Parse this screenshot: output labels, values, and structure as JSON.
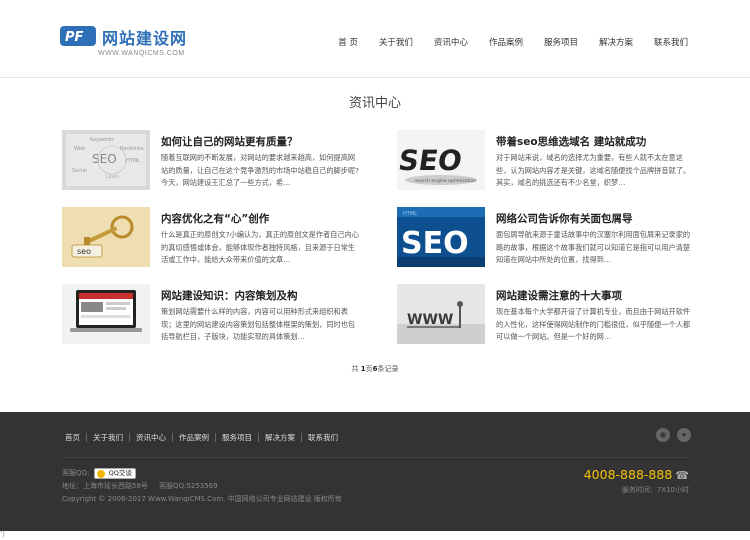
{
  "header": {
    "logo_text": "网站建设网",
    "logo_url": "WWW.WANQICMS.COM",
    "nav": [
      "首 页",
      "关于我们",
      "资讯中心",
      "作品案例",
      "服务项目",
      "解决方案",
      "联系我们"
    ]
  },
  "section_title": "资讯中心",
  "articles": [
    {
      "title": "如何让自己的网站更有质量？",
      "desc": "随着互联网的不断发展，对网站的要求越来越高，如何提高网站的质量，让自己在这个竞争激烈的市场中站稳自己的脚步呢?今天，网站建设王汇总了一些方式，希…",
      "thumb": "seo-keywords-gray"
    },
    {
      "title": "带着seo思维选域名 建站就成功",
      "desc": "对于网站来说，域名的选择尤为重要，有些人就不太在意这些，认为网站内容才是关键，这域名随便找个品牌拼音就了。其实，域名的挑选还有不少名堂，织梦…",
      "thumb": "seo-3d-dark"
    },
    {
      "title": "内容优化之有“心”创作",
      "desc": "什么是真正的原创文?小编认为，真正的原创文是作者自己内心的真切感悟或体会，能够体现作者独特风格，且来源于日常生活或工作中，能给大众带来价值的文章…",
      "thumb": "seo-golden-key"
    },
    {
      "title": "网络公司告诉你有关面包屑导",
      "desc": "面包屑导航来源于童话故事中的汉塞尔利用面包屑来记录家的路的故事，根据这个故事我们就可以知道它是指可以用户清楚知道在网站中所处的位置，找得到…",
      "thumb": "seo-blue"
    },
    {
      "title": "网站建设知识：内容策划及构",
      "desc": "策划网站需要什么样的内容，内容可以用种形式来组织和表现；这里的网站建设内容策划包括整体框架的策划，同时也包括导航栏目，子版块，功能实现的具体策划…",
      "thumb": "laptop-screen"
    },
    {
      "title": "网站建设需注意的十大事项",
      "desc": "现在基本每个大学都开设了计算机专业，而且由于网站开软件的人性化，这样使得网站制作的门槛很低，似乎随便一个人都可以做一个网站。但是一个好的网…",
      "thumb": "www-letters"
    }
  ],
  "pager": {
    "prefix": "共",
    "pages": "1",
    "middle": "页",
    "records": "6",
    "suffix": "条记录"
  },
  "footer": {
    "nav": [
      "首页",
      "关于我们",
      "资讯中心",
      "作品案例",
      "服务项目",
      "解决方案",
      "联系我们"
    ],
    "icons": [
      "weibo-icon",
      "qq-icon"
    ],
    "qq_label": "客服QQ:",
    "qq_button": "QQ交谈",
    "address": "地址：上海市延长西路58号",
    "qq_number": "客服QQ:5253569",
    "copyright": "Copyright © 2006-2017 Www.WanqiCMS.Com. 中国网络公司专业网站建设 版权所有",
    "phone": "4008-888-888",
    "hours": "服务时间：7X10小时"
  },
  "corner_text": "')"
}
